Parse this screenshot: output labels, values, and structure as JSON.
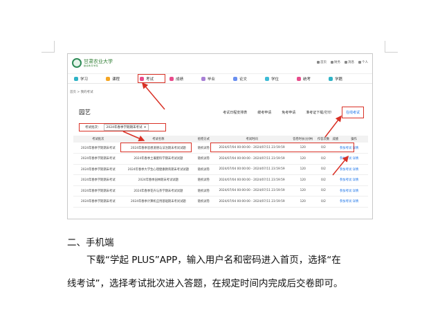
{
  "site": {
    "logo_title": "甘肃农业大学",
    "logo_subtitle": "继续教育学院"
  },
  "top_links": [
    "首页",
    "财务",
    "消息",
    "个人"
  ],
  "nav": {
    "items": [
      {
        "label": "学习",
        "color": "#2fb3c6"
      },
      {
        "label": "课程",
        "color": "#f5a623"
      },
      {
        "label": "考试",
        "color": "#e84c8b"
      },
      {
        "label": "成绩",
        "color": "#e84c8b"
      },
      {
        "label": "毕业",
        "color": "#a87fd6"
      },
      {
        "label": "论文",
        "color": "#6a8ff0"
      },
      {
        "label": "学位",
        "color": "#3dbbd6"
      },
      {
        "label": "统考",
        "color": "#e84c8b"
      },
      {
        "label": "学籍",
        "color": "#2fb3c6"
      }
    ]
  },
  "breadcrumb": "首页 > 我的考试",
  "page_title": "园艺",
  "tabs": [
    "考试日程安排表",
    "缓考申请",
    "免考申请",
    "准考证下载/打印",
    "在线考试"
  ],
  "filter": {
    "label": "考试批次：",
    "value": "2024年春季学期期末考试"
  },
  "table": {
    "headers": [
      "考试批次",
      "考试名称",
      "组卷方式",
      "考试时间",
      "答卷时长(分钟)",
      "作答次数",
      "成绩",
      "操作"
    ],
    "rows": [
      {
        "batch": "2024年春季学期期末考试",
        "name": "2024年春季思想道德与法治期末考试试题",
        "method": "随机试卷",
        "time": "2024/07/04 00:00:00 - 2024/07/11 23:59:59",
        "duration": "120",
        "attempts": "0/2",
        "score": "",
        "action": "参加考试 详情"
      },
      {
        "batch": "2024年春季学期期末考试",
        "name": "2024年春季土壤肥料学期末考试试题",
        "method": "随机试卷",
        "time": "2024/07/04 00:00:00 - 2024/07/11 23:59:59",
        "duration": "120",
        "attempts": "0/2",
        "score": "",
        "action": "参加考试 详情"
      },
      {
        "batch": "2024年春季学期期末考试",
        "name": "2024年春季大学生心理健康教育期末考试试题",
        "method": "随机试卷",
        "time": "2024/07/04 00:00:00 - 2024/07/11 23:59:59",
        "duration": "120",
        "attempts": "0/2",
        "score": "",
        "action": "参加考试 详情"
      },
      {
        "batch": "2024年春季学期期末考试",
        "name": "2024年春季园林期末考试试题",
        "method": "随机试卷",
        "time": "2024/07/04 00:00:00 - 2024/07/11 23:59:59",
        "duration": "120",
        "attempts": "0/2",
        "score": "",
        "action": "参加考试 详情"
      },
      {
        "batch": "2024年春季学期期末考试",
        "name": "2024年春季花卉与茶学期末考试试题",
        "method": "随机试卷",
        "time": "2024/07/04 00:00:00 - 2024/07/11 23:59:59",
        "duration": "120",
        "attempts": "0/2",
        "score": "",
        "action": "参加考试 详情"
      },
      {
        "batch": "2024年春季学期期末考试",
        "name": "2024年春季计算机应用基础期末考试试题",
        "method": "随机试卷",
        "time": "2024/07/04 00:00:00 - 2024/07/11 23:59:59",
        "duration": "120",
        "attempts": "0/2",
        "score": "",
        "action": "参加考试 详情"
      }
    ]
  },
  "doc": {
    "heading": "二、手机端",
    "para_line1": "下载“学起 PLUS”APP，输入用户名和密码进入首页，选择“在",
    "para_line2": "线考试”，选择考试批次进入答题，在规定时间内完成后交卷即可。"
  },
  "colors": {
    "highlight": "#d93025",
    "link": "#1a73e8"
  }
}
